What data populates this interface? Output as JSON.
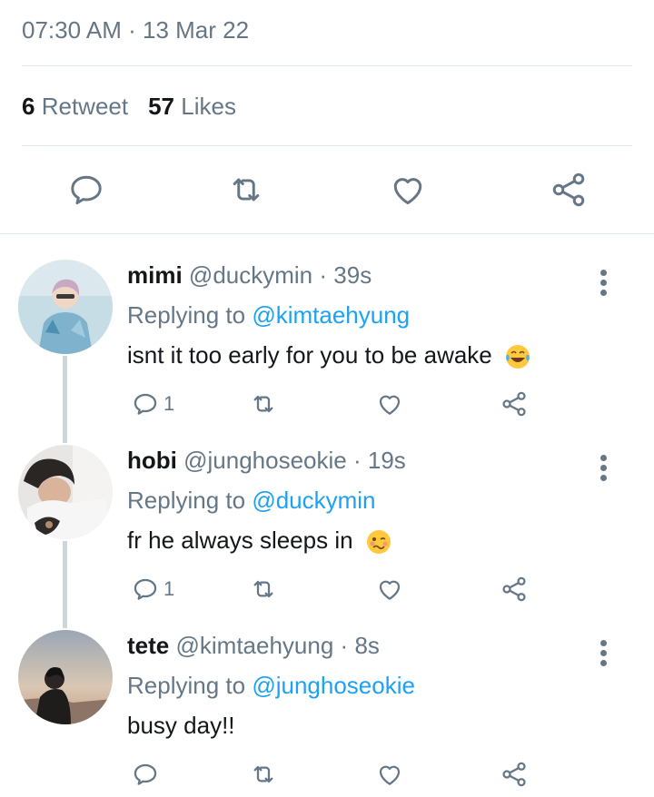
{
  "tweet": {
    "time": "07:30 AM",
    "separator": "·",
    "date": "13 Mar 22",
    "retweet_count": "6",
    "retweet_label": "Retweet",
    "like_count": "57",
    "like_label": "Likes"
  },
  "action_icons": [
    "reply-icon",
    "retweet-icon",
    "like-icon",
    "share-icon"
  ],
  "replies": [
    {
      "name": "mimi",
      "handle": "@duckymin",
      "time": "39s",
      "replying_prefix": "Replying to",
      "replying_to": "@kimtaehyung",
      "text": "isnt it too early for you to be awake",
      "emoji": "laughing-tears-emoji",
      "reply_count": "1"
    },
    {
      "name": "hobi",
      "handle": "@junghoseokie",
      "time": "19s",
      "replying_prefix": "Replying to",
      "replying_to": "@duckymin",
      "text": "fr he always sleeps in",
      "emoji": "woozy-face-emoji",
      "reply_count": "1"
    },
    {
      "name": "tete",
      "handle": "@kimtaehyung",
      "time": "8s",
      "replying_prefix": "Replying to",
      "replying_to": "@junghoseokie",
      "text": "busy day!!",
      "emoji": "",
      "reply_count": ""
    }
  ],
  "colors": {
    "link": "#1da1f2",
    "secondary_text": "#657786",
    "divider": "#e1e8ed",
    "thread_line": "#ccd6dd"
  }
}
